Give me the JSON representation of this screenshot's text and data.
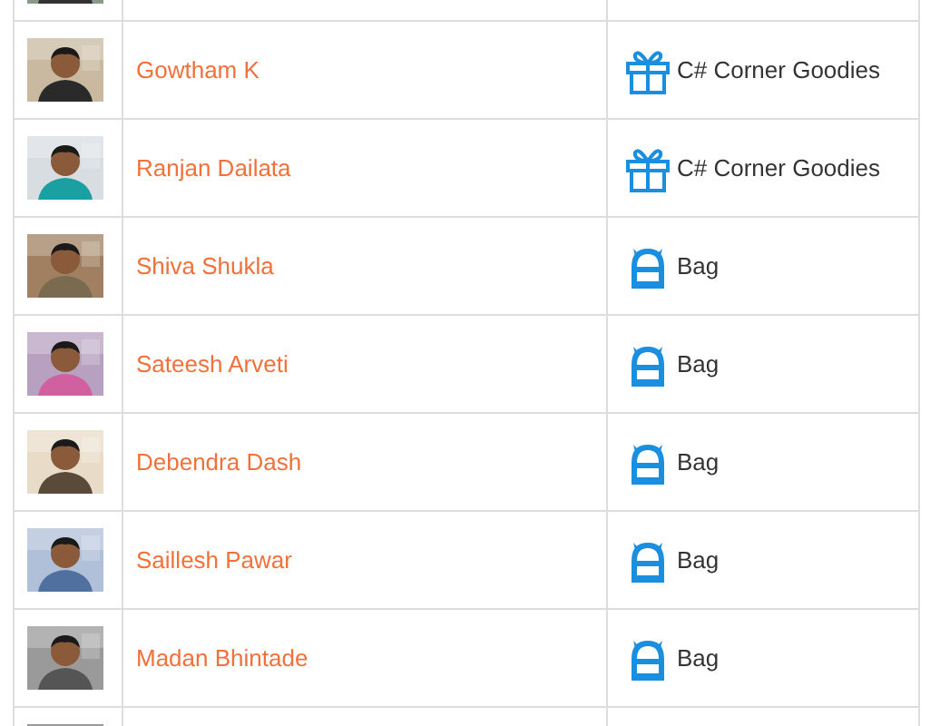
{
  "rows": [
    {
      "photo": {
        "kind": "picture"
      }
    },
    {
      "photo": {
        "kind": "picture"
      },
      "name": "Gowtham K",
      "prize": {
        "kind": "gift",
        "label": "C# Corner Goodies"
      }
    },
    {
      "photo": {
        "kind": "picture"
      },
      "name": "Ranjan Dailata",
      "prize": {
        "kind": "gift",
        "label": "C# Corner Goodies"
      }
    },
    {
      "photo": {
        "kind": "picture"
      },
      "name": "Shiva Shukla",
      "prize": {
        "kind": "bag",
        "label": "Bag"
      }
    },
    {
      "photo": {
        "kind": "picture"
      },
      "name": "Sateesh Arveti",
      "prize": {
        "kind": "bag",
        "label": "Bag"
      }
    },
    {
      "photo": {
        "kind": "picture"
      },
      "name": "Debendra Dash",
      "prize": {
        "kind": "bag",
        "label": "Bag"
      }
    },
    {
      "photo": {
        "kind": "picture"
      },
      "name": "Saillesh Pawar",
      "prize": {
        "kind": "bag",
        "label": "Bag"
      }
    },
    {
      "photo": {
        "kind": "picture"
      },
      "name": "Madan Bhintade",
      "prize": {
        "kind": "bag",
        "label": "Bag"
      }
    },
    {
      "photo": {
        "kind": "picture"
      }
    }
  ]
}
